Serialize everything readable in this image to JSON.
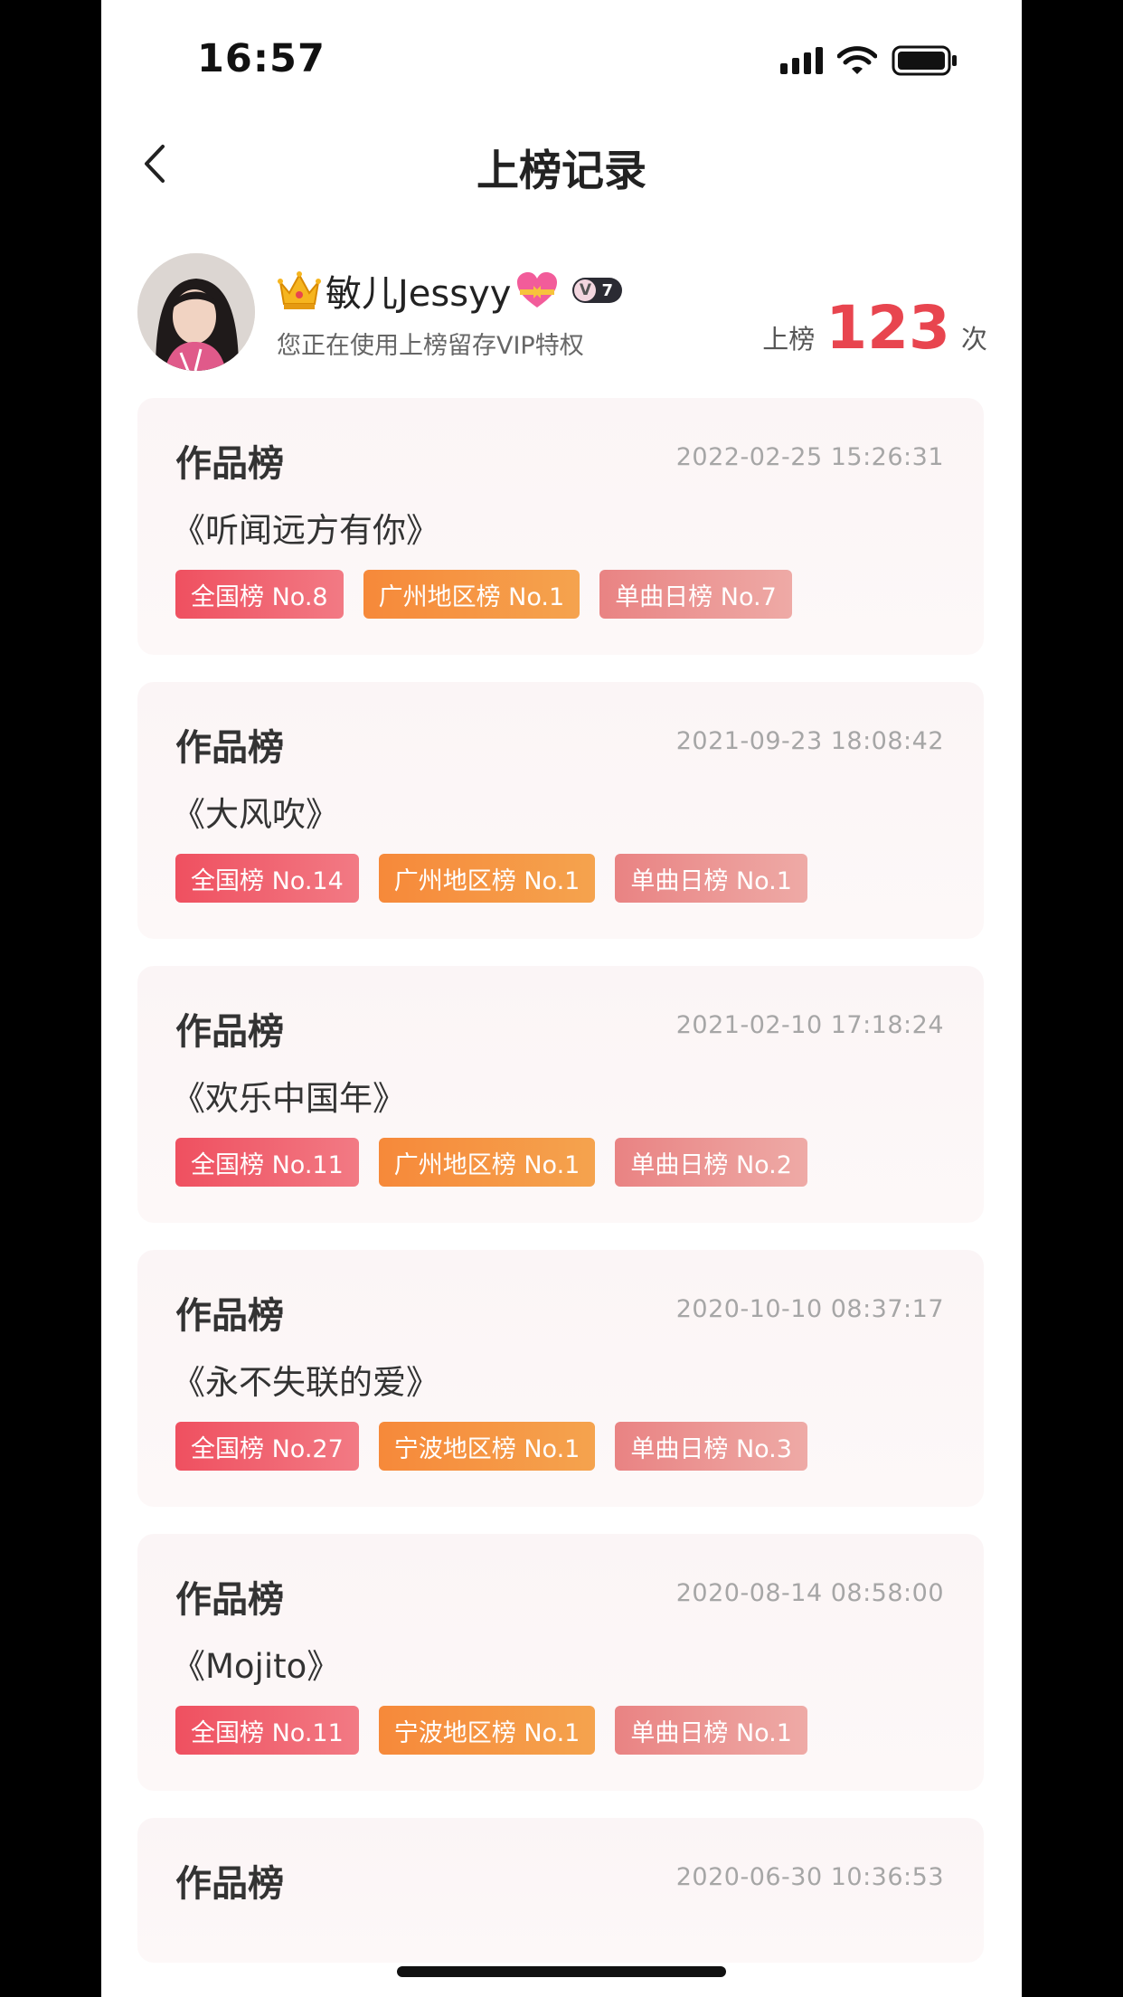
{
  "status_bar": {
    "time": "16:57"
  },
  "nav": {
    "title": "上榜记录"
  },
  "profile": {
    "name": "敏儿Jessyy",
    "level": "7",
    "level_v": "V",
    "vip_text": "您正在使用上榜留存VIP特权",
    "rank_prefix": "上榜",
    "rank_count": "123",
    "rank_suffix": "次"
  },
  "records": [
    {
      "title": "作品榜",
      "time": "2022-02-25 15:26:31",
      "song": "《听闻远方有你》",
      "tags": [
        "全国榜 No.8",
        "广州地区榜 No.1",
        "单曲日榜 No.7"
      ]
    },
    {
      "title": "作品榜",
      "time": "2021-09-23 18:08:42",
      "song": "《大风吹》",
      "tags": [
        "全国榜 No.14",
        "广州地区榜 No.1",
        "单曲日榜 No.1"
      ]
    },
    {
      "title": "作品榜",
      "time": "2021-02-10 17:18:24",
      "song": "《欢乐中国年》",
      "tags": [
        "全国榜 No.11",
        "广州地区榜 No.1",
        "单曲日榜 No.2"
      ]
    },
    {
      "title": "作品榜",
      "time": "2020-10-10 08:37:17",
      "song": "《永不失联的爱》",
      "tags": [
        "全国榜 No.27",
        "宁波地区榜 No.1",
        "单曲日榜 No.3"
      ]
    },
    {
      "title": "作品榜",
      "time": "2020-08-14 08:58:00",
      "song": "《Mojito》",
      "tags": [
        "全国榜 No.11",
        "宁波地区榜 No.1",
        "单曲日榜 No.1"
      ]
    },
    {
      "title": "作品榜",
      "time": "2020-06-30 10:36:53"
    }
  ],
  "colors": {
    "accent": "#e8454f",
    "tag_national": "#ef5060",
    "tag_region": "#f6893a",
    "tag_daily": "#e98383"
  },
  "icons": [
    "back-icon",
    "crown-icon",
    "heart-icon",
    "signal-icon",
    "wifi-icon",
    "battery-icon"
  ]
}
